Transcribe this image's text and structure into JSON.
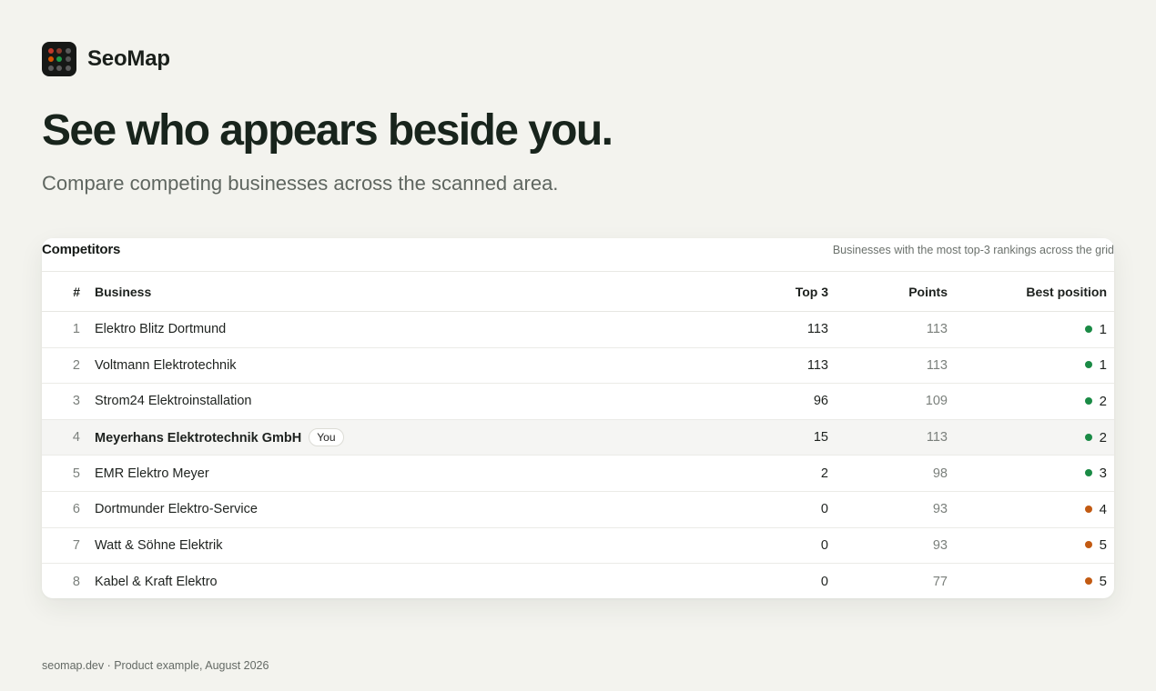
{
  "brand": {
    "name": "SeoMap",
    "logo_dots": [
      "#c0392b",
      "#8a3a2c",
      "#5a5a5a",
      "#d35400",
      "#1e9b4a",
      "#555555",
      "#5b5b5b",
      "#5b5b5b",
      "#5b5b5b"
    ]
  },
  "hero": {
    "title": "See who appears beside you.",
    "subtitle": "Compare competing businesses across the scanned area."
  },
  "competitors": {
    "title": "Competitors",
    "description": "Businesses with the most top-3 rankings across the grid",
    "columns": {
      "rank": "#",
      "business": "Business",
      "top3": "Top 3",
      "points": "Points",
      "best_position": "Best position"
    },
    "you_label": "You",
    "status_colors": {
      "top": "#1a8a45",
      "mid": "#c25a12"
    },
    "rows": [
      {
        "rank": "1",
        "business": "Elektro Blitz Dortmund",
        "top3": "113",
        "points": "113",
        "best": "1",
        "status": "top",
        "you": false
      },
      {
        "rank": "2",
        "business": "Voltmann Elektrotechnik",
        "top3": "113",
        "points": "113",
        "best": "1",
        "status": "top",
        "you": false
      },
      {
        "rank": "3",
        "business": "Strom24 Elektroinstallation",
        "top3": "96",
        "points": "109",
        "best": "2",
        "status": "top",
        "you": false
      },
      {
        "rank": "4",
        "business": "Meyerhans Elektrotechnik GmbH",
        "top3": "15",
        "points": "113",
        "best": "2",
        "status": "top",
        "you": true
      },
      {
        "rank": "5",
        "business": "EMR Elektro Meyer",
        "top3": "2",
        "points": "98",
        "best": "3",
        "status": "top",
        "you": false
      },
      {
        "rank": "6",
        "business": "Dortmunder Elektro-Service",
        "top3": "0",
        "points": "93",
        "best": "4",
        "status": "mid",
        "you": false
      },
      {
        "rank": "7",
        "business": "Watt & Söhne Elektrik",
        "top3": "0",
        "points": "93",
        "best": "5",
        "status": "mid",
        "you": false
      },
      {
        "rank": "8",
        "business": "Kabel & Kraft Elektro",
        "top3": "0",
        "points": "77",
        "best": "5",
        "status": "mid",
        "you": false
      }
    ]
  },
  "footer": {
    "text": "seomap.dev · Product example, August 2026"
  }
}
